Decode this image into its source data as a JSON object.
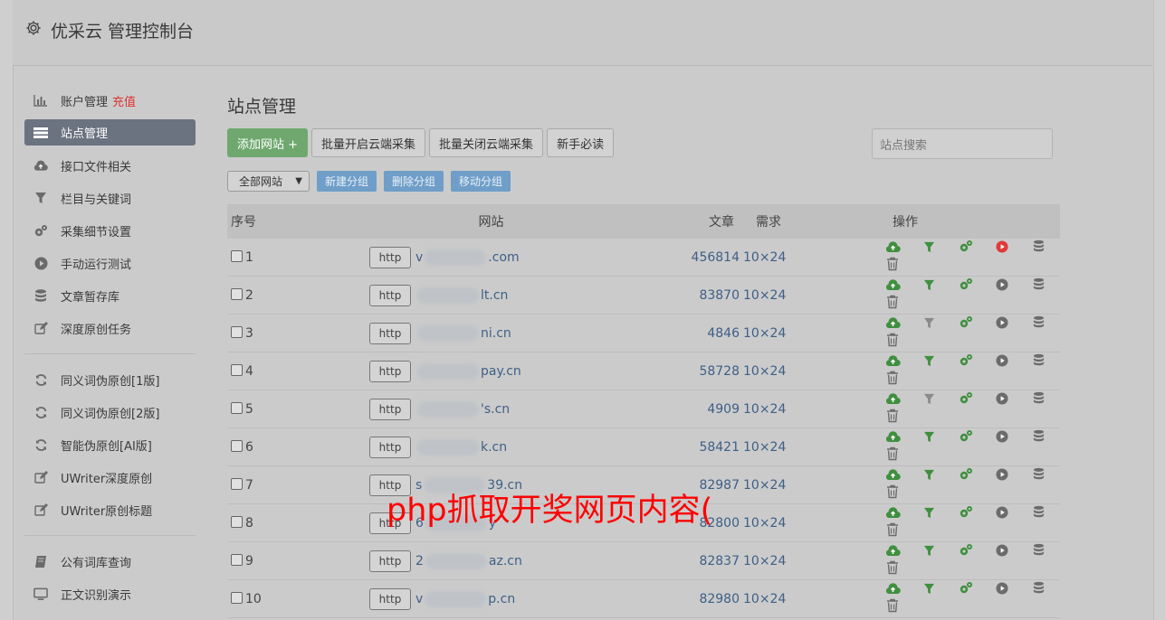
{
  "app": {
    "title": "优采云 管理控制台"
  },
  "sidebar": {
    "group1": [
      {
        "label": "账户管理",
        "badge": "充值",
        "icon": "bar-chart-icon"
      },
      {
        "label": "站点管理",
        "icon": "list-icon",
        "active": true
      },
      {
        "label": "接口文件相关",
        "icon": "cloud-upload-icon"
      },
      {
        "label": "栏目与关键词",
        "icon": "filter-icon"
      },
      {
        "label": "采集细节设置",
        "icon": "gears-icon"
      },
      {
        "label": "手动运行测试",
        "icon": "play-icon"
      },
      {
        "label": "文章暂存库",
        "icon": "database-icon"
      },
      {
        "label": "深度原创任务",
        "icon": "edit-icon"
      }
    ],
    "group2": [
      {
        "label": "同义词伪原创[1版]",
        "icon": "refresh-icon"
      },
      {
        "label": "同义词伪原创[2版]",
        "icon": "refresh-icon"
      },
      {
        "label": "智能伪原创[AI版]",
        "icon": "refresh-icon"
      },
      {
        "label": "UWriter深度原创",
        "icon": "edit-icon"
      },
      {
        "label": "UWriter原创标题",
        "icon": "edit-icon"
      }
    ],
    "group3": [
      {
        "label": "公有词库查询",
        "icon": "book-icon"
      },
      {
        "label": "正文识别演示",
        "icon": "monitor-icon"
      }
    ]
  },
  "main": {
    "title": "站点管理",
    "toolbar": {
      "add": "添加网站 +",
      "batch_on": "批量开启云端采集",
      "batch_off": "批量关闭云端采集",
      "guide": "新手必读"
    },
    "search_placeholder": "站点搜索",
    "group_select": "全部网站",
    "group_buttons": {
      "new": "新建分组",
      "delete": "删除分组",
      "move": "移动分组"
    },
    "table": {
      "headers": {
        "no": "序号",
        "site": "网站",
        "articles": "文章",
        "demand": "需求",
        "ops": "操作"
      },
      "rows": [
        {
          "no": "1",
          "proto": "http",
          "pre": "v",
          "post": ".com",
          "articles": "456814",
          "demand": "10×24",
          "run_active": true,
          "filter_active": true
        },
        {
          "no": "2",
          "proto": "http",
          "pre": "",
          "post": "lt.cn",
          "articles": "83870",
          "demand": "10×24",
          "run_active": false,
          "filter_active": true
        },
        {
          "no": "3",
          "proto": "http",
          "pre": "",
          "post": "ni.cn",
          "articles": "4846",
          "demand": "10×24",
          "run_active": false,
          "filter_active": false
        },
        {
          "no": "4",
          "proto": "http",
          "pre": "",
          "post": "pay.cn",
          "articles": "58728",
          "demand": "10×24",
          "run_active": false,
          "filter_active": true
        },
        {
          "no": "5",
          "proto": "http",
          "pre": "",
          "post": "'s.cn",
          "articles": "4909",
          "demand": "10×24",
          "run_active": false,
          "filter_active": false
        },
        {
          "no": "6",
          "proto": "http",
          "pre": "",
          "post": "k.cn",
          "articles": "58421",
          "demand": "10×24",
          "run_active": false,
          "filter_active": true
        },
        {
          "no": "7",
          "proto": "http",
          "pre": "s",
          "post": "39.cn",
          "articles": "82987",
          "demand": "10×24",
          "run_active": false,
          "filter_active": true
        },
        {
          "no": "8",
          "proto": "http",
          "pre": "6",
          "post": "y",
          "articles": "82800",
          "demand": "10×24",
          "run_active": false,
          "filter_active": true
        },
        {
          "no": "9",
          "proto": "http",
          "pre": "2",
          "post": "az.cn",
          "articles": "82837",
          "demand": "10×24",
          "run_active": false,
          "filter_active": true
        },
        {
          "no": "10",
          "proto": "http",
          "pre": "v",
          "post": "p.cn",
          "articles": "82980",
          "demand": "10×24",
          "run_active": false,
          "filter_active": true
        }
      ]
    }
  },
  "watermark": "php抓取开奖网页内容(",
  "colors": {
    "green": "#3f8f3f",
    "red": "#e03a3a",
    "grey_icon": "#6b6b6b",
    "link": "#3e5f86",
    "primary_btn": "#6fa86f",
    "group_btn": "#6f9ec8"
  }
}
